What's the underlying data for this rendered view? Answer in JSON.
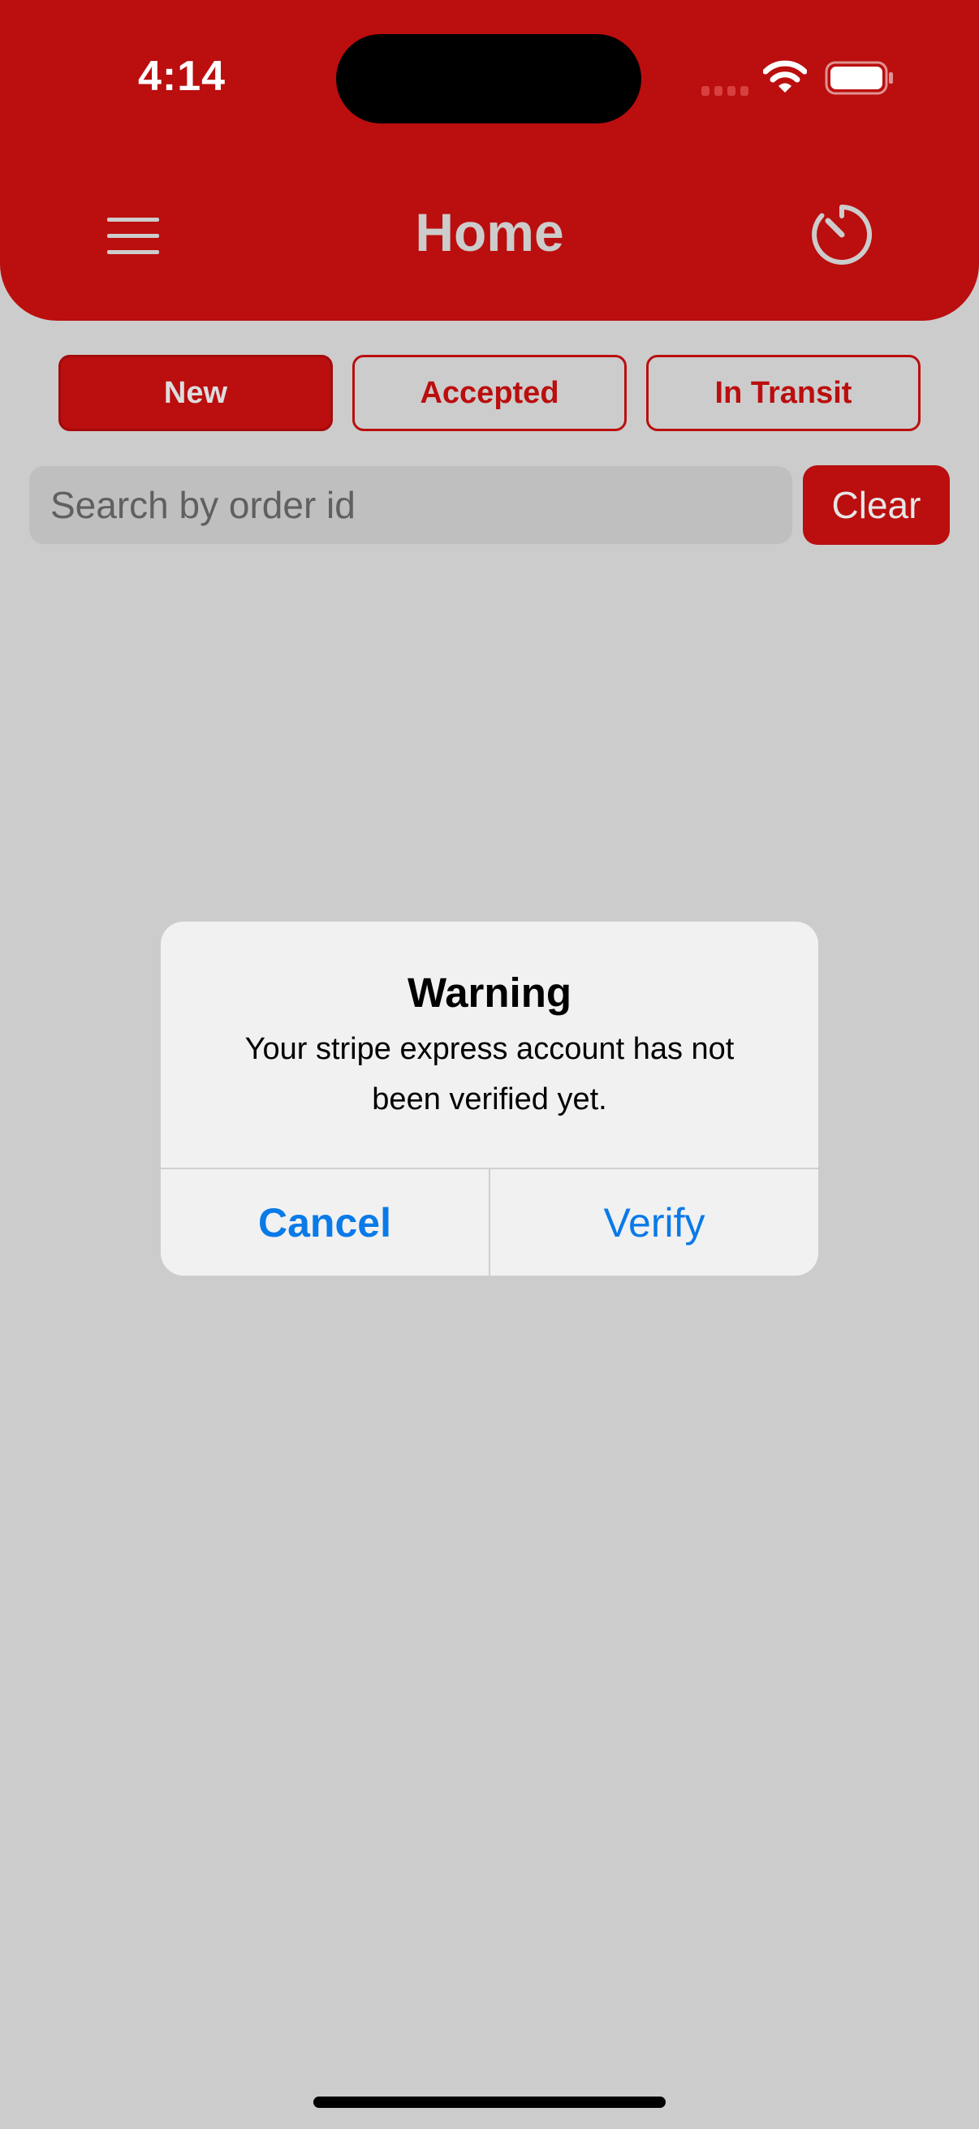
{
  "status_bar": {
    "time": "4:14"
  },
  "header": {
    "title": "Home",
    "menu_icon": "hamburger-menu-icon",
    "timer_icon": "timer-icon"
  },
  "tabs": [
    {
      "label": "New",
      "active": true
    },
    {
      "label": "Accepted",
      "active": false
    },
    {
      "label": "In Transit",
      "active": false
    }
  ],
  "search": {
    "placeholder": "Search by order id",
    "value": "",
    "clear_label": "Clear"
  },
  "alert": {
    "title": "Warning",
    "message": "Your stripe express account has not been verified yet.",
    "cancel_label": "Cancel",
    "verify_label": "Verify"
  },
  "colors": {
    "brand_red": "#bb0e0e",
    "background": "#cccccc",
    "alert_background": "#f1f1f1",
    "alert_button_blue": "#0a7ae8"
  }
}
